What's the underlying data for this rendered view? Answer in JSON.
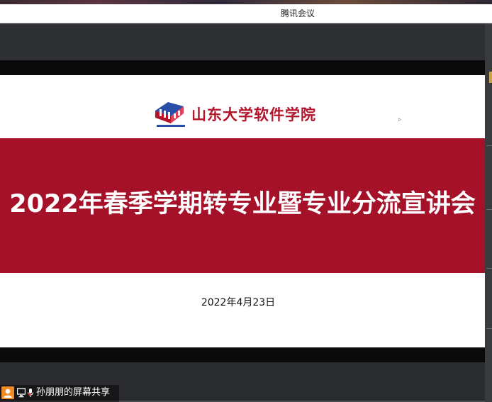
{
  "window": {
    "title": "腾讯会议"
  },
  "slide": {
    "logo_text": "山东大学软件学院",
    "title": "2022年春季学期转专业暨专业分流宣讲会",
    "date": "2022年4月23日"
  },
  "screen_share": {
    "label": "孙朋朋的屏幕共享"
  },
  "colors": {
    "slide_red": "#a6112a",
    "avatar_orange": "#f08a24",
    "logo_blue": "#2a4fa8"
  },
  "icons": [
    "user-avatar-icon",
    "screen-share-icon",
    "microphone-icon",
    "mouse-pointer-icon"
  ]
}
